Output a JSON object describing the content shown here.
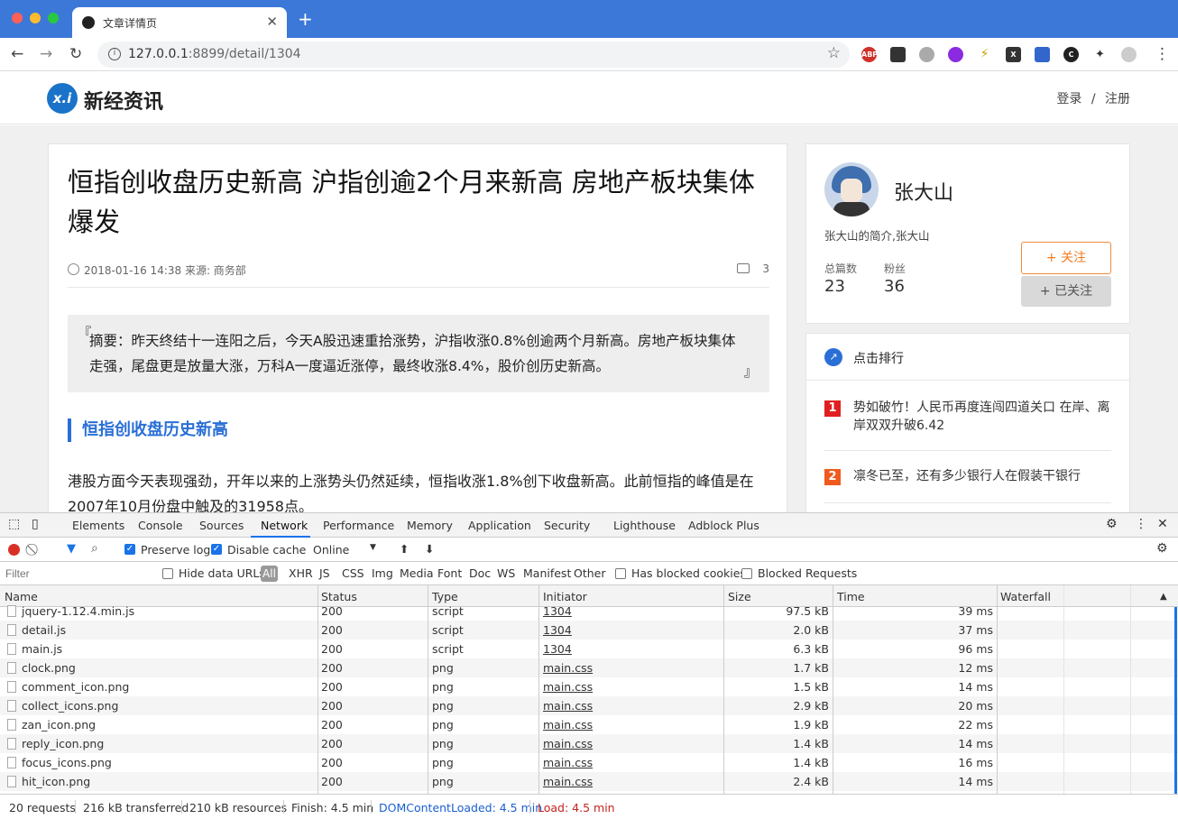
{
  "browser": {
    "tab_title": "文章详情页",
    "url_host": "127.0.0.1",
    "url_rest": ":8899/detail/1304",
    "new_tab": "+",
    "close": "✕",
    "extensions": [
      "ABP",
      "QR",
      "globe",
      "mic",
      "bolt",
      "X",
      "trans",
      "C",
      "puzzle",
      "profile"
    ]
  },
  "site": {
    "logo_mark": "x.i",
    "logo_text": "新经资讯",
    "login": "登录",
    "divider": "/",
    "register": "注册"
  },
  "article": {
    "title": "恒指创收盘历史新高 沪指创逾2个月来新高 房地产板块集体爆发",
    "meta": "2018-01-16 14:38 来源: 商务部",
    "comment_count": "3",
    "summary_open": "『",
    "summary": "摘要：昨天终结十一连阳之后，今天A股迅速重拾涨势，沪指收涨0.8%创逾两个月新高。房地产板块集体走强，尾盘更是放量大涨，万科A一度逼近涨停，最终收涨8.4%，股价创历史新高。",
    "summary_close": "』",
    "heading": "恒指创收盘历史新高",
    "paragraph": "港股方面今天表现强劲，开年以来的上涨势头仍然延续，恒指收涨1.8%创下收盘新高。此前恒指的峰值是在2007年10月份盘中触及的31958点。"
  },
  "author": {
    "name": "张大山",
    "intro": "张大山的简介,张大山",
    "total_label": "总篇数",
    "total": "23",
    "fans_label": "粉丝",
    "fans": "36",
    "follow": "+ 关注",
    "followed": "+ 已关注"
  },
  "ranking": {
    "title": "点击排行",
    "items": [
      {
        "num": "1",
        "text": "势如破竹！人民币再度连闯四道关口 在岸、离岸双双升破6.42",
        "color": "#e02020"
      },
      {
        "num": "2",
        "text": "凛冬已至，还有多少银行人在假装干银行",
        "color": "#f05a1e"
      }
    ]
  },
  "devtools": {
    "tabs": [
      "Elements",
      "Console",
      "Sources",
      "Network",
      "Performance",
      "Memory",
      "Application",
      "Security",
      "Lighthouse",
      "Adblock Plus"
    ],
    "active_tab": "Network",
    "preserve_log": "Preserve log",
    "disable_cache": "Disable cache",
    "throttle": "Online",
    "filter_placeholder": "Filter",
    "hide_data_urls": "Hide data URLs",
    "all": "All",
    "types": [
      "XHR",
      "JS",
      "CSS",
      "Img",
      "Media",
      "Font",
      "Doc",
      "WS",
      "Manifest",
      "Other"
    ],
    "has_blocked": "Has blocked cookies",
    "blocked_requests": "Blocked Requests",
    "columns": [
      "Name",
      "Status",
      "Type",
      "Initiator",
      "Size",
      "Time",
      "Waterfall"
    ],
    "rows": [
      {
        "name": "jquery-1.12.4.min.js",
        "status": "200",
        "type": "script",
        "initiator": "1304",
        "size": "97.5 kB",
        "time": "39 ms"
      },
      {
        "name": "detail.js",
        "status": "200",
        "type": "script",
        "initiator": "1304",
        "size": "2.0 kB",
        "time": "37 ms"
      },
      {
        "name": "main.js",
        "status": "200",
        "type": "script",
        "initiator": "1304",
        "size": "6.3 kB",
        "time": "96 ms"
      },
      {
        "name": "clock.png",
        "status": "200",
        "type": "png",
        "initiator": "main.css",
        "size": "1.7 kB",
        "time": "12 ms"
      },
      {
        "name": "comment_icon.png",
        "status": "200",
        "type": "png",
        "initiator": "main.css",
        "size": "1.5 kB",
        "time": "14 ms"
      },
      {
        "name": "collect_icons.png",
        "status": "200",
        "type": "png",
        "initiator": "main.css",
        "size": "2.9 kB",
        "time": "20 ms"
      },
      {
        "name": "zan_icon.png",
        "status": "200",
        "type": "png",
        "initiator": "main.css",
        "size": "1.9 kB",
        "time": "22 ms"
      },
      {
        "name": "reply_icon.png",
        "status": "200",
        "type": "png",
        "initiator": "main.css",
        "size": "1.4 kB",
        "time": "14 ms"
      },
      {
        "name": "focus_icons.png",
        "status": "200",
        "type": "png",
        "initiator": "main.css",
        "size": "1.4 kB",
        "time": "16 ms"
      },
      {
        "name": "hit_icon.png",
        "status": "200",
        "type": "png",
        "initiator": "main.css",
        "size": "2.4 kB",
        "time": "14 ms"
      }
    ],
    "status_bar": {
      "requests": "20 requests",
      "transferred": "216 kB transferred",
      "resources": "210 kB resources",
      "finish": "Finish: 4.5 min",
      "dcl": "DOMContentLoaded: 4.5 min",
      "load": "Load: 4.5 min"
    }
  }
}
